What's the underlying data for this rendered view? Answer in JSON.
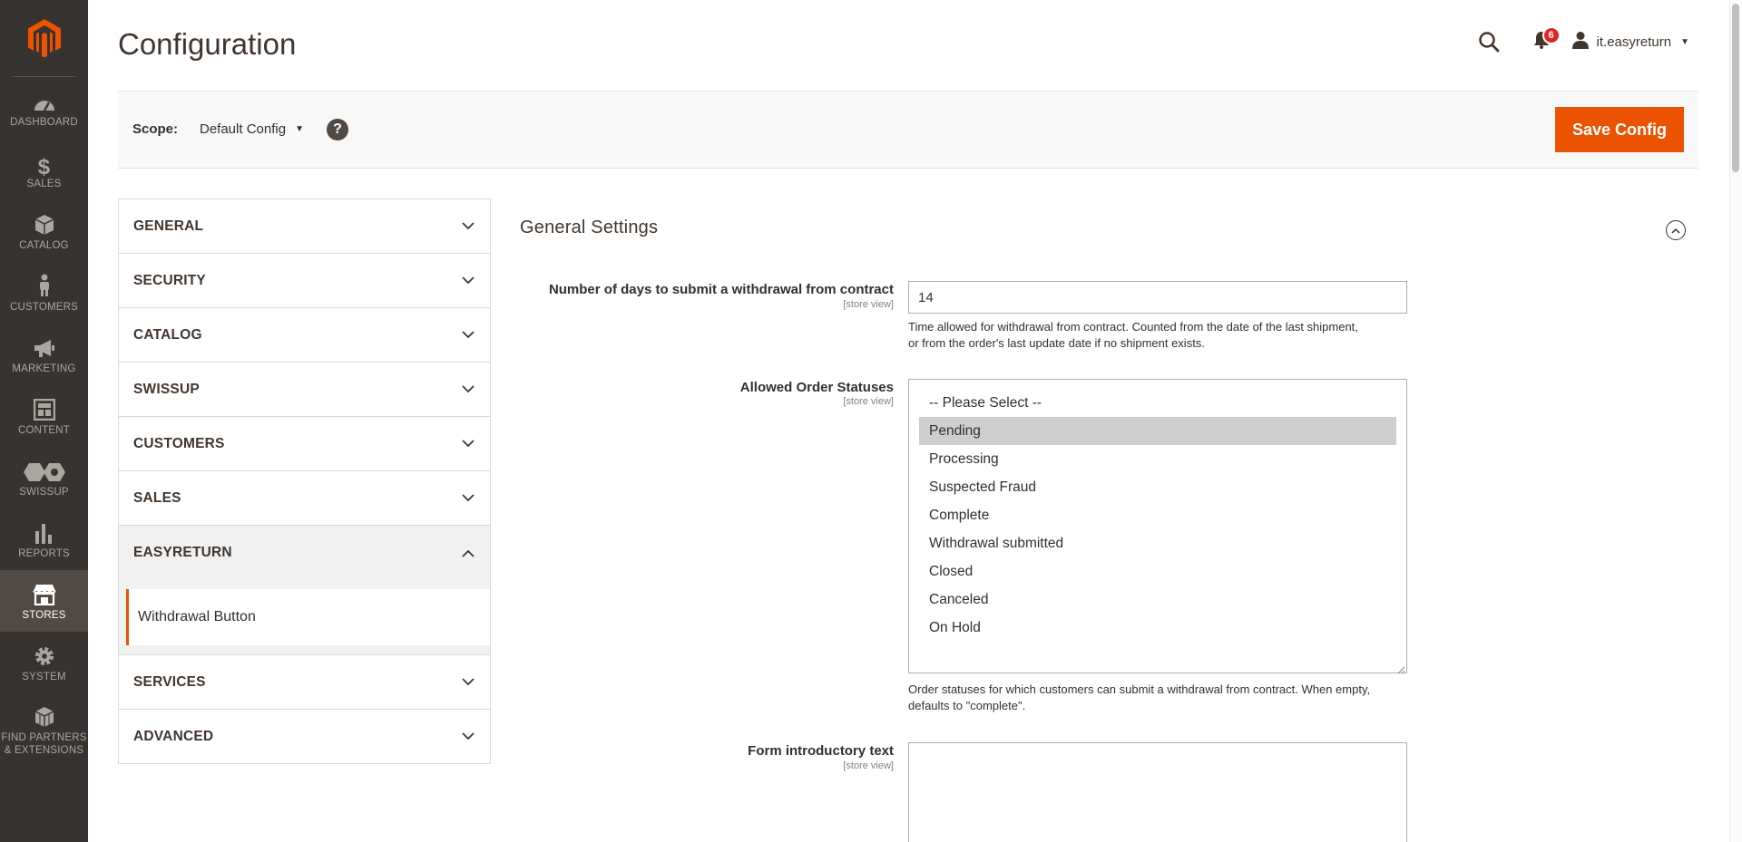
{
  "nav": {
    "items": [
      {
        "label": "DASHBOARD",
        "icon": "dashboard-icon"
      },
      {
        "label": "SALES",
        "icon": "dollar-icon"
      },
      {
        "label": "CATALOG",
        "icon": "box-icon"
      },
      {
        "label": "CUSTOMERS",
        "icon": "person-icon"
      },
      {
        "label": "MARKETING",
        "icon": "megaphone-icon"
      },
      {
        "label": "CONTENT",
        "icon": "layout-icon"
      },
      {
        "label": "SWISSUP",
        "icon": "hexagons-icon"
      },
      {
        "label": "REPORTS",
        "icon": "bar-chart-icon"
      },
      {
        "label": "STORES",
        "icon": "storefront-icon"
      },
      {
        "label": "SYSTEM",
        "icon": "gear-icon"
      },
      {
        "label1": "FIND PARTNERS",
        "label2": "& EXTENSIONS",
        "icon": "cubes-icon"
      }
    ],
    "active": "STORES"
  },
  "header": {
    "title": "Configuration",
    "notification_count": "6",
    "username": "it.easyreturn"
  },
  "scope": {
    "label": "Scope:",
    "value": "Default Config",
    "help": "?"
  },
  "actions": {
    "save_label": "Save Config"
  },
  "tabs": [
    {
      "label": "GENERAL"
    },
    {
      "label": "SECURITY"
    },
    {
      "label": "CATALOG"
    },
    {
      "label": "SWISSUP"
    },
    {
      "label": "CUSTOMERS"
    },
    {
      "label": "SALES"
    },
    {
      "label": "EASYRETURN",
      "open": true,
      "subitems": [
        "Withdrawal Button"
      ]
    },
    {
      "label": "SERVICES"
    },
    {
      "label": "ADVANCED"
    }
  ],
  "section": {
    "title": "General Settings",
    "fields": {
      "days": {
        "label": "Number of days to submit a withdrawal from contract",
        "scope": "[store view]",
        "value": "14",
        "note_line1": "Time allowed for withdrawal from contract. Counted from the date of the last shipment,",
        "note_line2": "or from the order's last update date if no shipment exists."
      },
      "statuses": {
        "label": "Allowed Order Statuses",
        "scope": "[store view]",
        "options": [
          "-- Please Select --",
          "Pending",
          "Processing",
          "Suspected Fraud",
          "Complete",
          "Withdrawal submitted",
          "Closed",
          "Canceled",
          "On Hold"
        ],
        "selected": "Pending",
        "note_line1": "Order statuses for which customers can submit a withdrawal from contract. When empty,",
        "note_line2": "defaults to \"complete\"."
      },
      "intro": {
        "label": "Form introductory text",
        "scope": "[store view]",
        "value": ""
      }
    }
  },
  "colors": {
    "accent": "#eb5202",
    "nav_bg": "#373330",
    "nav_active": "#514943",
    "badge": "#e22626"
  }
}
